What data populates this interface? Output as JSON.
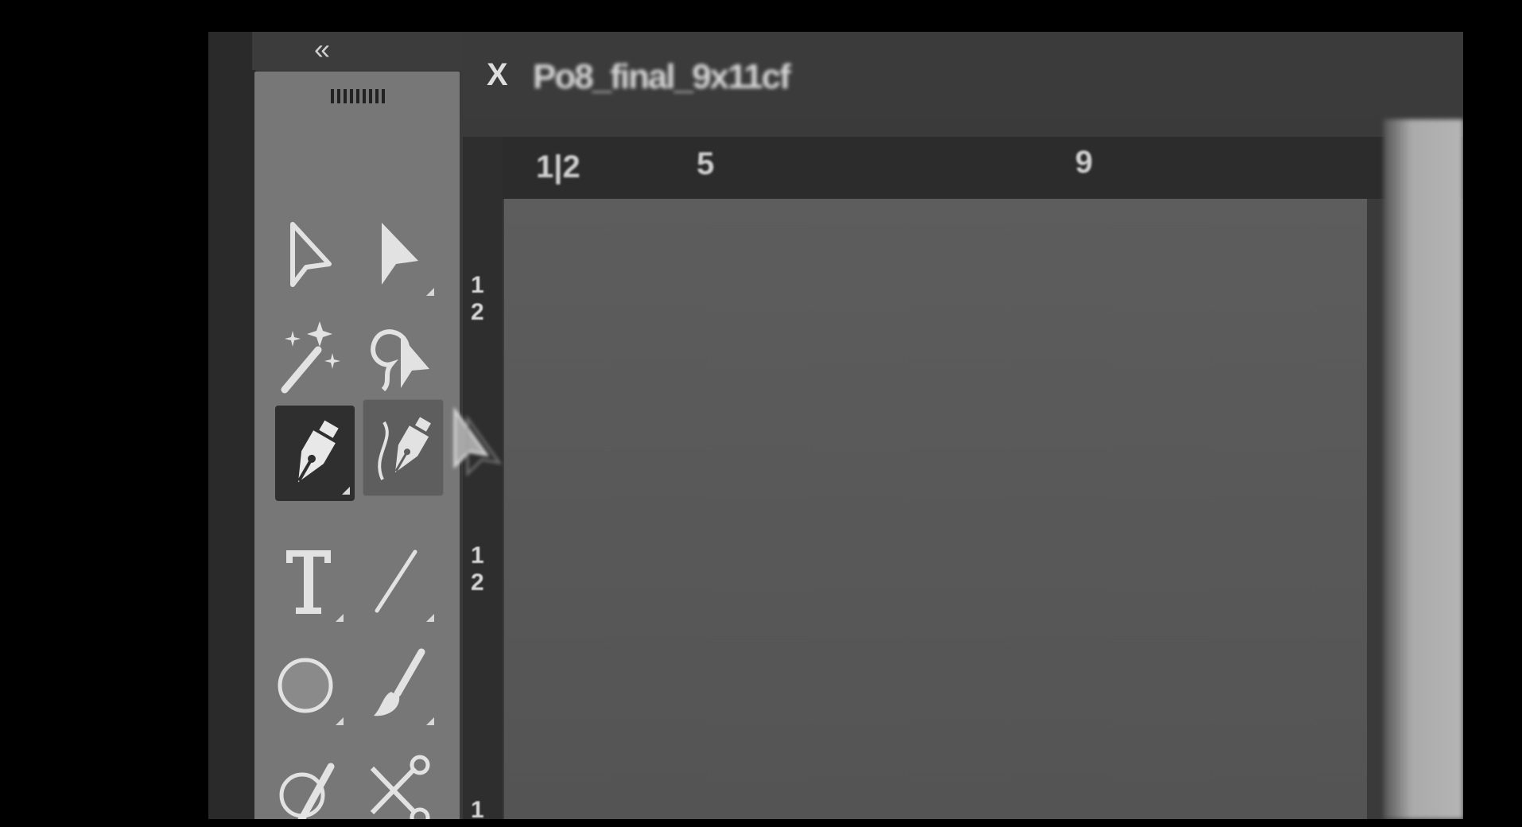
{
  "window": {
    "collapse_glyph": "«",
    "tab": {
      "close_glyph": "X",
      "title": "Po8_final_9x11cf"
    }
  },
  "ruler": {
    "top_labels": [
      "1|2",
      "5",
      "9"
    ],
    "left_labels": [
      [
        "1",
        "2"
      ],
      [
        "1",
        "2"
      ],
      [
        "1"
      ]
    ]
  },
  "toolbar": {
    "tools": [
      {
        "name": "selection-tool",
        "icon": "arrow-outline-icon",
        "state": "normal"
      },
      {
        "name": "direct-selection-tool",
        "icon": "arrow-filled-icon",
        "state": "normal"
      },
      {
        "name": "magic-wand-tool",
        "icon": "magic-wand-icon",
        "state": "normal"
      },
      {
        "name": "lasso-tool",
        "icon": "lasso-icon",
        "state": "normal"
      },
      {
        "name": "pen-tool",
        "icon": "pen-icon",
        "state": "active"
      },
      {
        "name": "curvature-tool",
        "icon": "curvature-pen-icon",
        "state": "hover"
      },
      {
        "name": "type-tool",
        "icon": "type-icon",
        "state": "normal"
      },
      {
        "name": "line-segment-tool",
        "icon": "line-icon",
        "state": "normal"
      },
      {
        "name": "ellipse-tool",
        "icon": "ellipse-icon",
        "state": "normal"
      },
      {
        "name": "paintbrush-tool",
        "icon": "brush-icon",
        "state": "normal"
      },
      {
        "name": "shaper-tool",
        "icon": "shaper-icon",
        "state": "normal"
      },
      {
        "name": "scissors-tool",
        "icon": "scissors-icon",
        "state": "normal"
      }
    ]
  },
  "colors": {
    "toolbar_bg": "#777777",
    "active_tool_bg": "#2f2f2f",
    "canvas": "#595959"
  }
}
